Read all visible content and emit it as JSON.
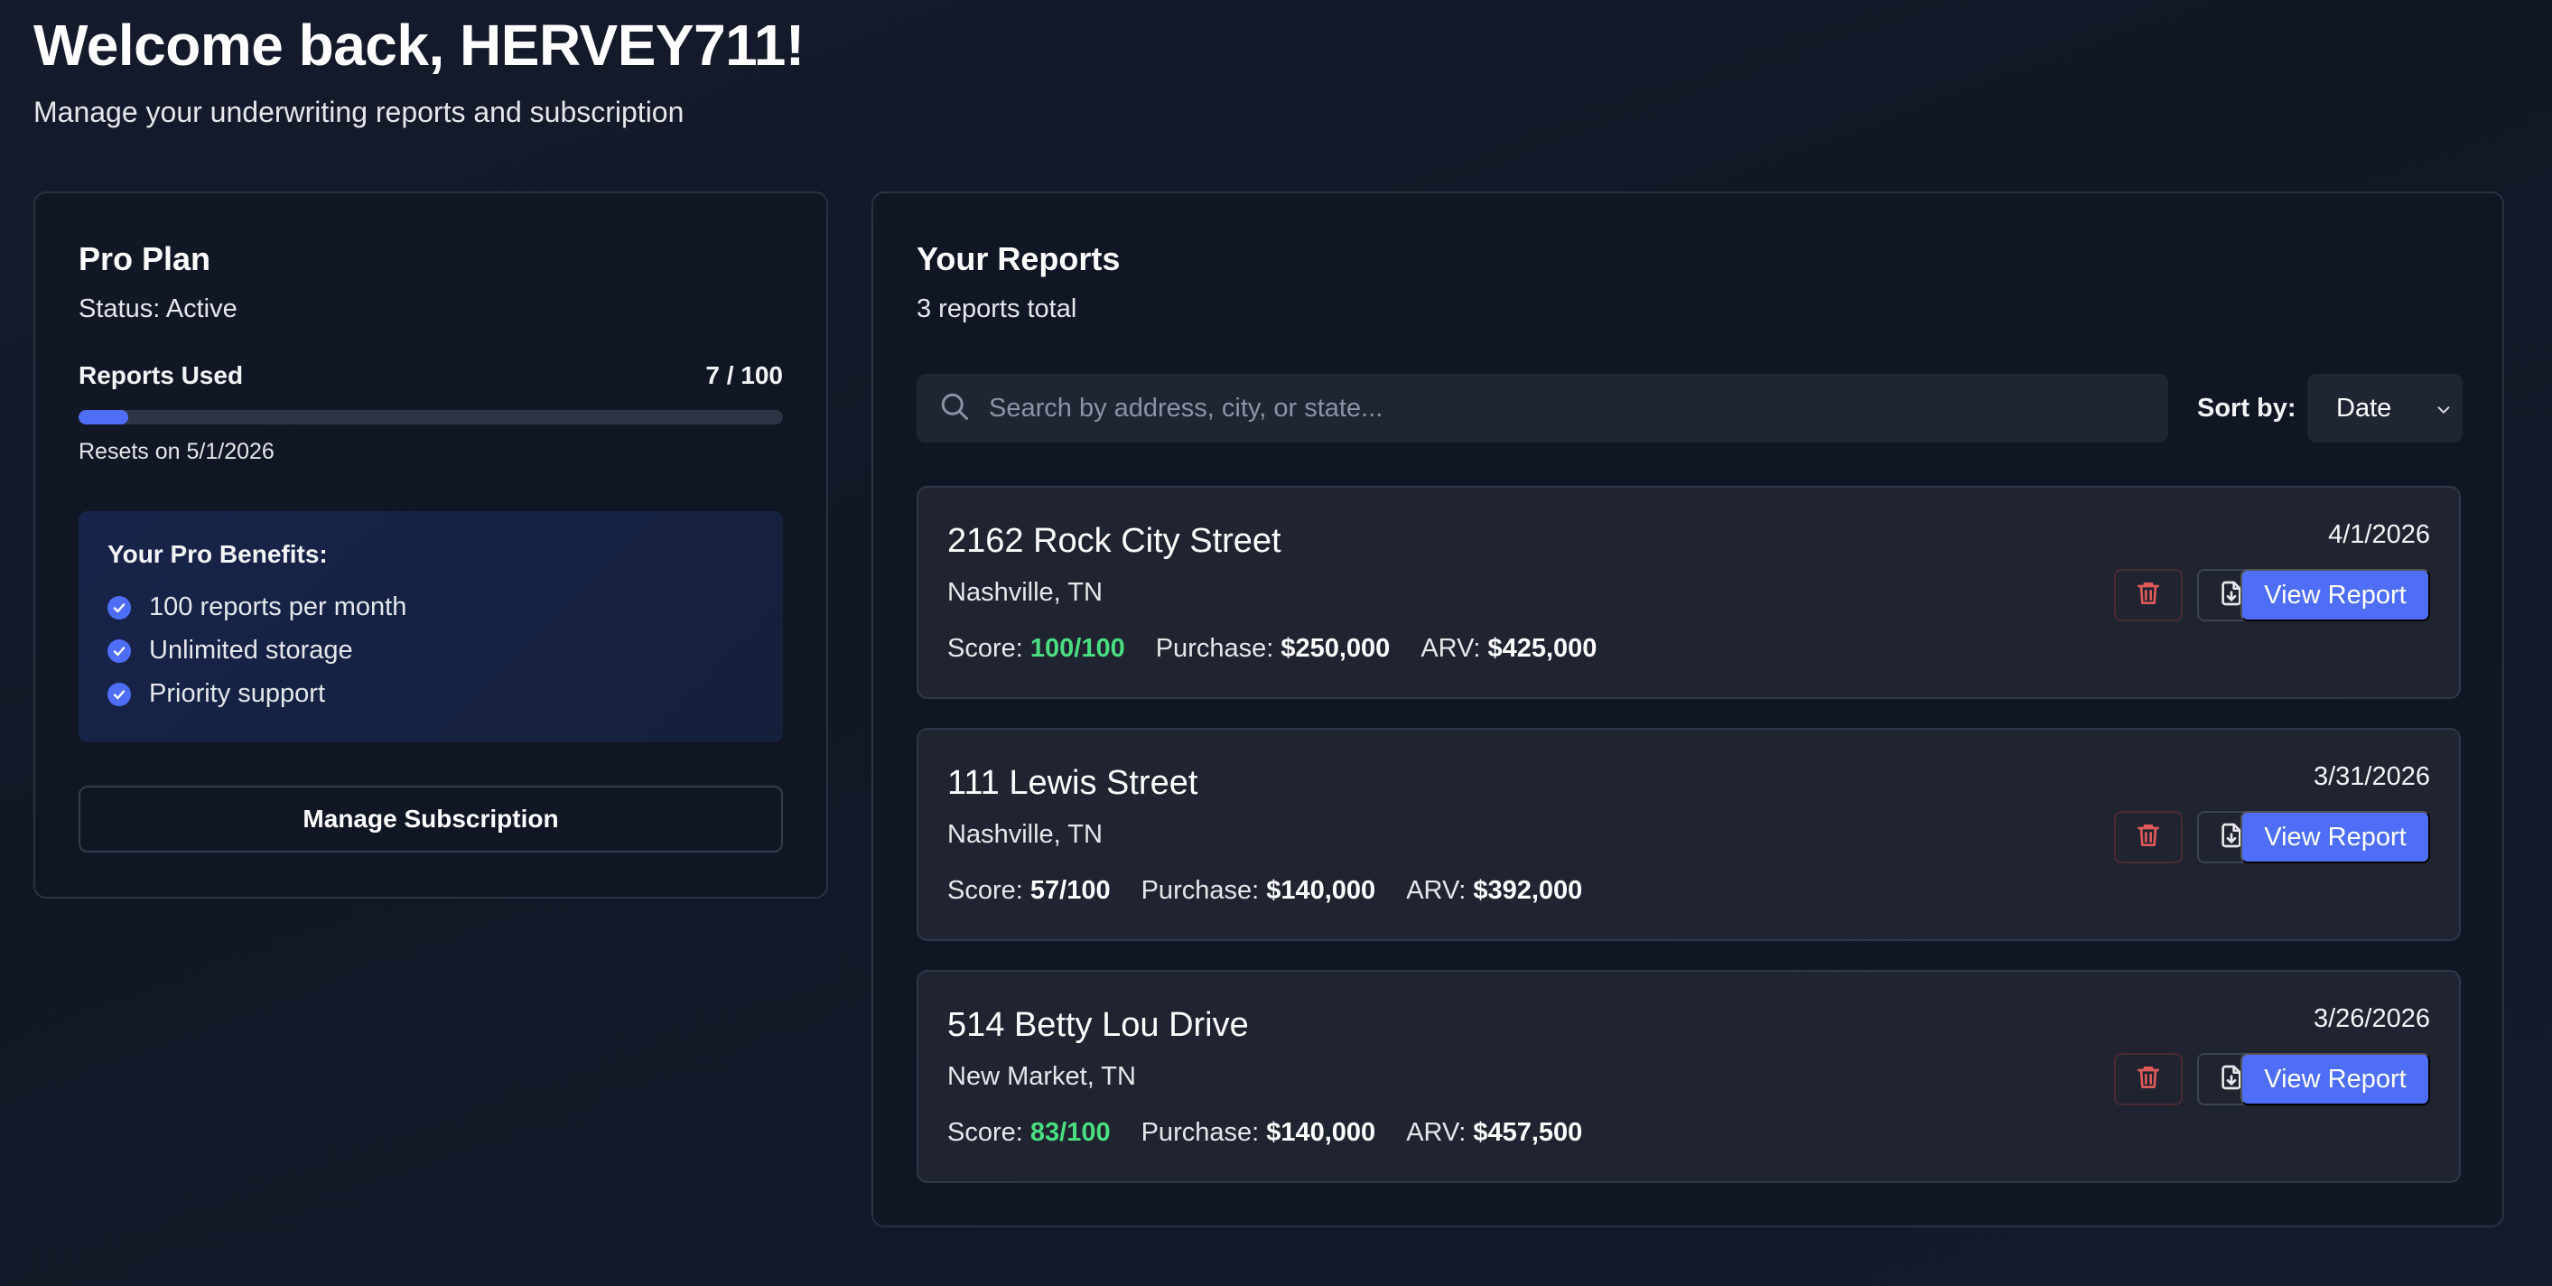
{
  "header": {
    "title": "Welcome back, HERVEY711!",
    "subtitle": "Manage your underwriting reports and subscription"
  },
  "plan": {
    "name": "Pro Plan",
    "status": "Status: Active",
    "usage_label": "Reports Used",
    "usage_count": "7 / 100",
    "usage_used": 7,
    "usage_limit": 100,
    "reset_text": "Resets on 5/1/2026",
    "benefits_title": "Your Pro Benefits:",
    "benefits": [
      "100 reports per month",
      "Unlimited storage",
      "Priority support"
    ],
    "manage_label": "Manage Subscription"
  },
  "reports": {
    "title": "Your Reports",
    "count_text": "3 reports total",
    "search_placeholder": "Search by address, city, or state...",
    "sort_label": "Sort by:",
    "sort_value": "Date",
    "score_label": "Score:",
    "purchase_label": "Purchase:",
    "arv_label": "ARV:",
    "view_label": "View Report",
    "items": [
      {
        "address": "2162 Rock City Street",
        "city": "Nashville, TN",
        "score": "100/100",
        "purchase": "$250,000",
        "arv": "$425,000",
        "date": "4/1/2026"
      },
      {
        "address": "111 Lewis Street",
        "city": "Nashville, TN",
        "score": "57/100",
        "purchase": "$140,000",
        "arv": "$392,000",
        "date": "3/31/2026"
      },
      {
        "address": "514 Betty Lou Drive",
        "city": "New Market, TN",
        "score": "83/100",
        "purchase": "$140,000",
        "arv": "$457,500",
        "date": "3/26/2026"
      }
    ]
  },
  "colors": {
    "background": "#121726",
    "accent": "#4f6ef7",
    "score_good": "#4ade80",
    "delete": "#e05a5a"
  }
}
